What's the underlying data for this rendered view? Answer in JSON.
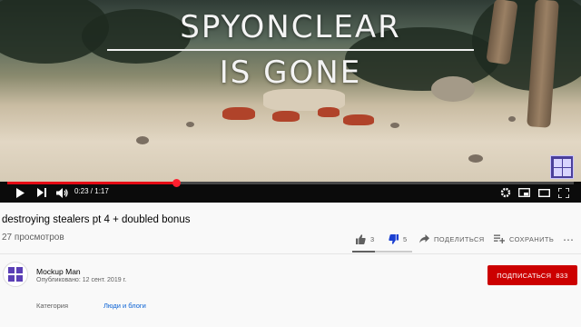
{
  "video": {
    "overlay_line1": "SPYONCLEAR",
    "overlay_line2": "IS GONE",
    "time_display": "0:23 / 1:17",
    "progress_fraction": 0.298,
    "buffer_fraction": 0.3
  },
  "player_controls": {
    "icons": [
      "play-icon",
      "next-icon",
      "volume-icon",
      "settings-icon",
      "miniplayer-icon",
      "theater-icon",
      "fullscreen-icon"
    ]
  },
  "info": {
    "title": "destroying stealers pt 4 + doubled bonus",
    "views": "27 просмотров",
    "likes": "3",
    "dislikes": "5",
    "share_label": "ПОДЕЛИТЬСЯ",
    "save_label": "СОХРАНИТЬ",
    "like_fraction": 0.375
  },
  "channel": {
    "name": "Mockup Man",
    "published": "Опубликовано: 12 сент. 2019 г.",
    "subscribe_label": "ПОДПИСАТЬСЯ",
    "subscriber_count": "833"
  },
  "meta": {
    "category_label": "Категория",
    "category_value": "Люди и блоги"
  },
  "colors": {
    "accent_red": "#cc0000",
    "progress_red": "#e50914",
    "link_blue": "#065fd4"
  }
}
